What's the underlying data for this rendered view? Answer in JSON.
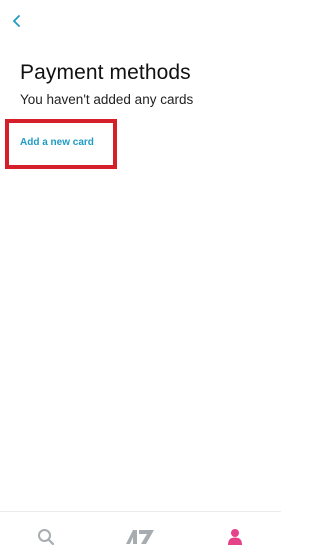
{
  "header": {
    "back_icon": "chevron-left-icon"
  },
  "page": {
    "title": "Payment methods",
    "subtitle": "You haven't added any cards",
    "add_card_label": "Add a new card"
  },
  "tab_bar": {
    "items": [
      {
        "icon": "search-icon",
        "active": false
      },
      {
        "icon": "brand-logo-icon",
        "active": false
      },
      {
        "icon": "profile-icon",
        "active": true
      }
    ]
  },
  "colors": {
    "accent": "#1f9bc4",
    "highlight": "#d51f2b",
    "active_tab": "#e6428a",
    "inactive_tab": "#a7acb1"
  }
}
